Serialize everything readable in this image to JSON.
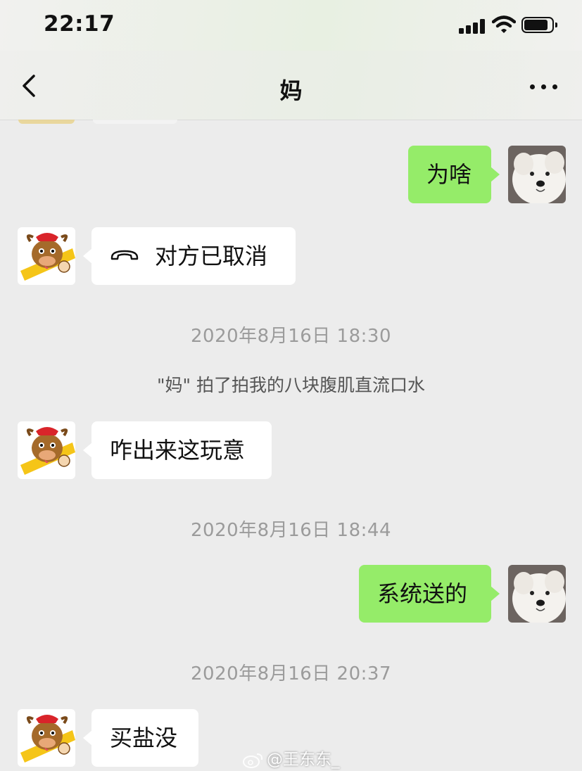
{
  "status_bar": {
    "time": "22:17",
    "signal_icon": "cellular-signal-icon",
    "wifi_icon": "wifi-icon",
    "battery_icon": "battery-icon"
  },
  "nav": {
    "back_icon": "chevron-left-icon",
    "title": "妈",
    "more_icon": "more-dots-icon"
  },
  "messages": [
    {
      "side": "out",
      "text": "为啥"
    },
    {
      "side": "in",
      "text": "对方已取消",
      "icon": "phone-hangup-icon"
    },
    {
      "timestamp": "2020年8月16日 18:30"
    },
    {
      "system": "\"妈\" 拍了拍我的八块腹肌直流口水"
    },
    {
      "side": "in",
      "text": "咋出来这玩意"
    },
    {
      "timestamp": "2020年8月16日 18:44"
    },
    {
      "side": "out",
      "text": "系统送的"
    },
    {
      "timestamp": "2020年8月16日 20:37"
    },
    {
      "side": "in",
      "text": "买盐没"
    }
  ],
  "watermark": {
    "icon": "weibo-icon",
    "text": "@王东东_"
  },
  "colors": {
    "chat_background": "#ececec",
    "outgoing_bubble": "#95ec69",
    "incoming_bubble": "#ffffff",
    "timestamp_text": "#9b9b9b"
  }
}
